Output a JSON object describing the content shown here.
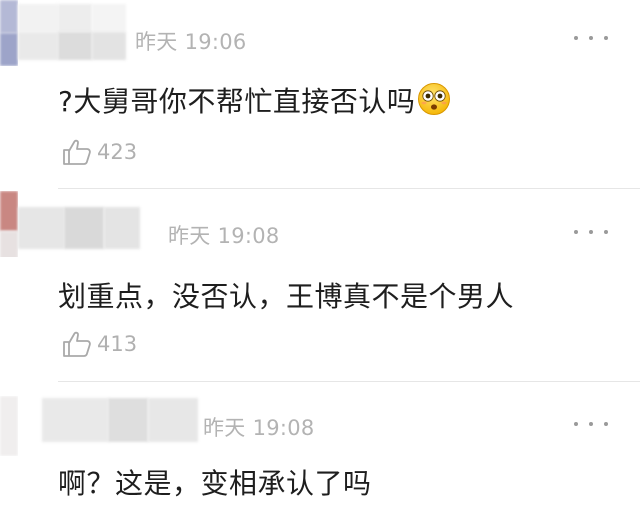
{
  "comments": [
    {
      "timestamp": "昨天 19:06",
      "text": "?大舅哥你不帮忙直接否认吗",
      "emoji": "flushed-face-emoji",
      "likes": "423",
      "username_hidden": true
    },
    {
      "timestamp": "昨天 19:08",
      "text": "划重点，没否认，王博真不是个男人",
      "likes": "413",
      "username_hidden": true
    },
    {
      "timestamp": "昨天 19:08",
      "text": "啊？这是，变相承认了吗",
      "username_hidden": true
    }
  ],
  "icons": {
    "like": "thumbs-up-outline-icon",
    "more": "more-dots-icon"
  },
  "colors": {
    "meta_text": "#b3b3b3",
    "body_text": "#1e1e1e",
    "divider": "#e6e6e6",
    "avatar_tint_1": "#9aa3c8",
    "avatar_tint_2": "#c97f7a"
  }
}
